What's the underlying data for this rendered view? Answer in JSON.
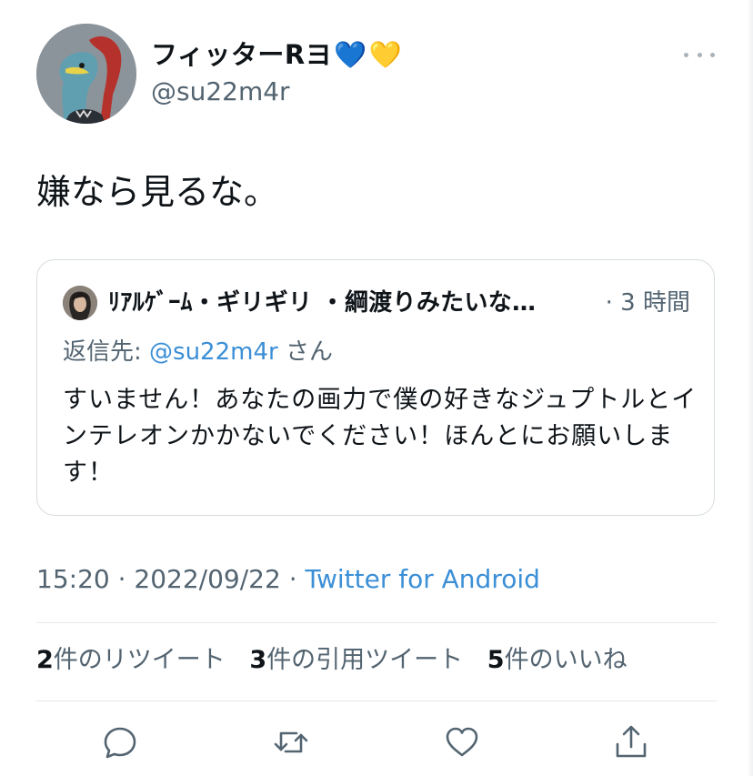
{
  "author": {
    "name": "フィッターRヨ",
    "heart1": "💙",
    "heart2": "💛",
    "handle": "@su22m4r"
  },
  "tweet": {
    "text": "嫌なら見るな。"
  },
  "quote": {
    "name": "ﾘｱﾙｹﾞｰﾑ・ギリギリ ・綱渡りみたいな…",
    "time": "· 3 時間",
    "reply_prefix": "返信先: ",
    "reply_mention": "@su22m4r",
    "reply_suffix": " さん",
    "body": "すいません！あなたの画力で僕の好きなジュプトルとインテレオンかかないでください！ほんとにお願いします！"
  },
  "meta": {
    "time": "15:20",
    "separator1": " · ",
    "date": "2022/09/22",
    "separator2": " · ",
    "source": "Twitter for Android"
  },
  "stats": {
    "retweets_count": "2",
    "retweets_label": "件のリツイート",
    "quotes_count": "3",
    "quotes_label": "件の引用ツイート",
    "likes_count": "5",
    "likes_label": "件のいいね"
  },
  "actions": {
    "reply_icon": "reply-icon",
    "retweet_icon": "retweet-icon",
    "like_icon": "heart-icon",
    "share_icon": "share-icon"
  },
  "colors": {
    "text": "#0f1419",
    "secondary": "#536471",
    "link": "#3b8fd6",
    "border": "#d6dce0"
  }
}
